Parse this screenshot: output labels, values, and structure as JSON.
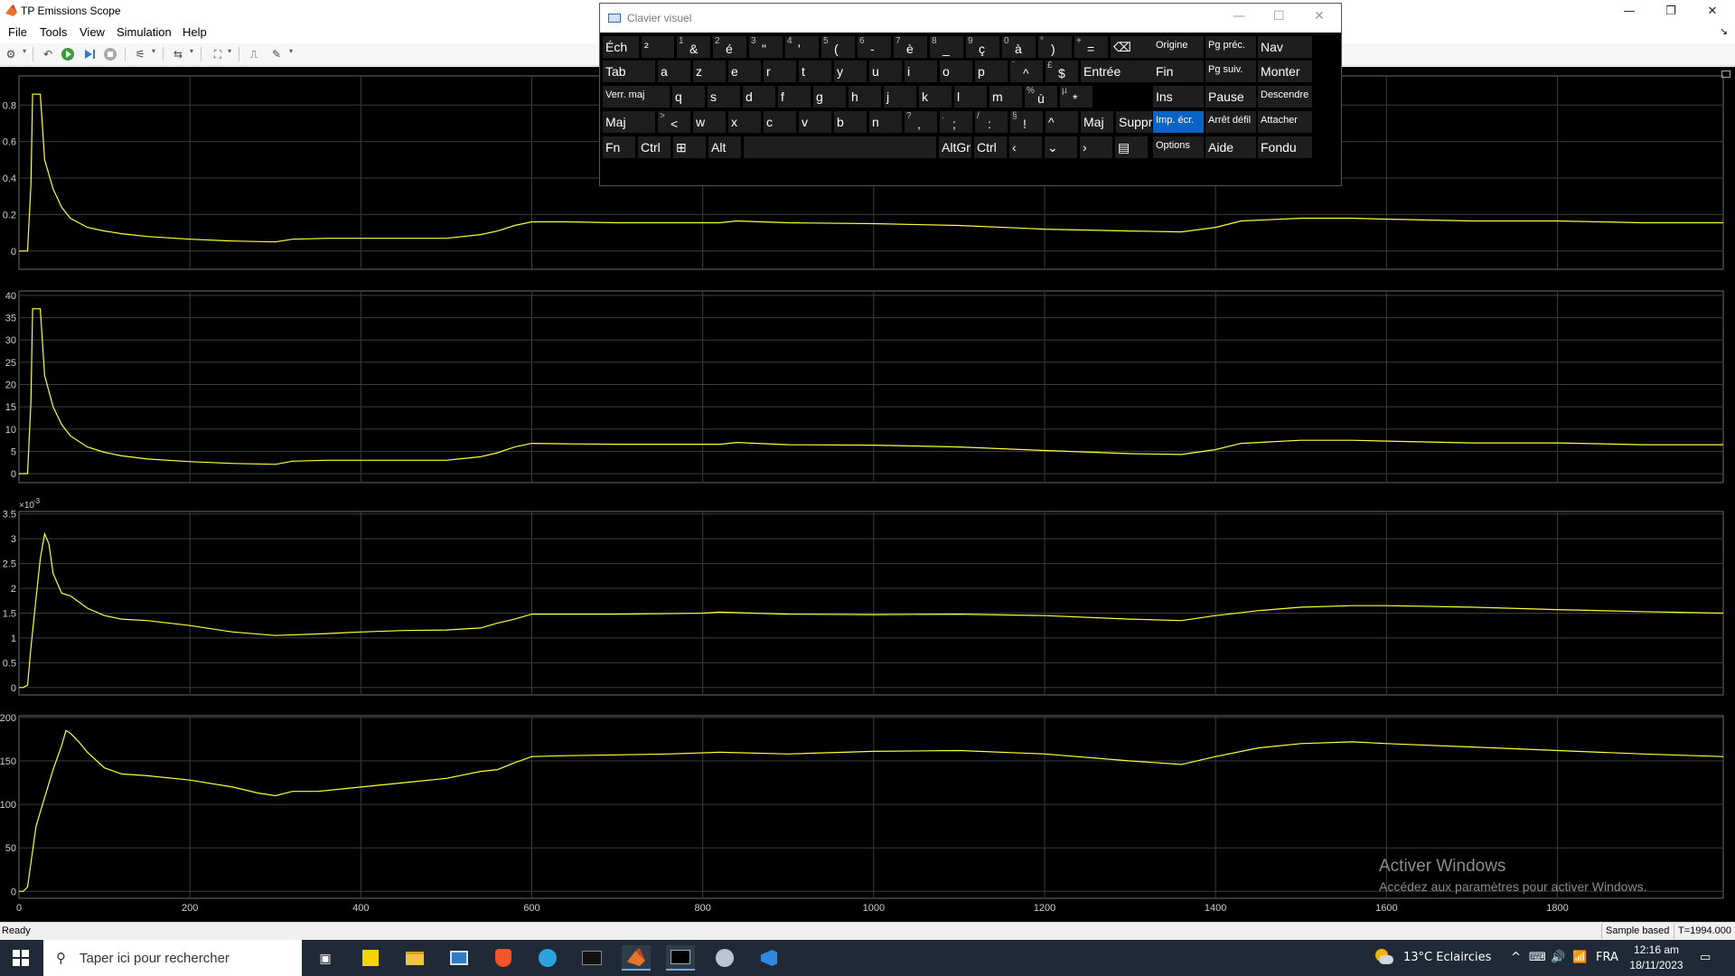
{
  "window": {
    "title": "TP Emissions Scope",
    "controls": {
      "minimize": "—",
      "restore": "❐",
      "close": "✕"
    }
  },
  "menu": [
    "File",
    "Tools",
    "View",
    "Simulation",
    "Help"
  ],
  "toolbar_icons": [
    "settings-icon",
    "restore-snapshot-icon",
    "run-icon",
    "step-forward-icon",
    "stop-icon",
    "signal-selector-icon",
    "zoom-icon",
    "fit-axes-icon",
    "trigger-icon",
    "measurements-icon"
  ],
  "chart_data": [
    {
      "type": "line",
      "yticks": [
        "0",
        "0.2",
        "0.4",
        "0.6",
        "0.8"
      ],
      "ylim": [
        -0.1,
        0.96
      ],
      "x": [
        0,
        5,
        10,
        14,
        16,
        20,
        25,
        30,
        40,
        50,
        60,
        80,
        100,
        120,
        150,
        200,
        250,
        300,
        320,
        360,
        400,
        450,
        500,
        540,
        560,
        580,
        600,
        640,
        700,
        760,
        820,
        840,
        900,
        1000,
        1100,
        1200,
        1300,
        1360,
        1400,
        1430,
        1500,
        1560,
        1600,
        1700,
        1800,
        1900,
        1994
      ],
      "values": [
        0,
        0,
        0,
        0.36,
        0.86,
        0.86,
        0.86,
        0.5,
        0.34,
        0.24,
        0.18,
        0.13,
        0.11,
        0.095,
        0.08,
        0.065,
        0.055,
        0.05,
        0.065,
        0.07,
        0.07,
        0.07,
        0.07,
        0.09,
        0.11,
        0.14,
        0.16,
        0.16,
        0.155,
        0.155,
        0.155,
        0.165,
        0.155,
        0.15,
        0.14,
        0.12,
        0.11,
        0.105,
        0.13,
        0.165,
        0.18,
        0.18,
        0.175,
        0.165,
        0.165,
        0.155,
        0.155
      ]
    },
    {
      "type": "line",
      "yticks": [
        "0",
        "5",
        "10",
        "15",
        "20",
        "25",
        "30",
        "35",
        "40"
      ],
      "ylim": [
        -2,
        41
      ],
      "x": [
        0,
        5,
        10,
        14,
        16,
        20,
        25,
        30,
        40,
        50,
        60,
        80,
        100,
        120,
        150,
        200,
        250,
        300,
        320,
        360,
        400,
        450,
        500,
        540,
        560,
        580,
        600,
        640,
        700,
        760,
        820,
        840,
        900,
        1000,
        1100,
        1200,
        1300,
        1360,
        1400,
        1430,
        1500,
        1560,
        1600,
        1700,
        1800,
        1900,
        1994
      ],
      "values": [
        0,
        0,
        0,
        16,
        37,
        37,
        37,
        22,
        15,
        11,
        8.5,
        6,
        4.8,
        4,
        3.3,
        2.7,
        2.3,
        2.1,
        2.8,
        3,
        3,
        3,
        3,
        3.8,
        4.7,
        6,
        6.8,
        6.7,
        6.6,
        6.6,
        6.6,
        7,
        6.5,
        6.4,
        6,
        5.2,
        4.5,
        4.3,
        5.4,
        6.8,
        7.5,
        7.5,
        7.3,
        6.9,
        6.9,
        6.5,
        6.5
      ]
    },
    {
      "type": "line",
      "exponent_label": "×10",
      "exponent_power": "-3",
      "yticks": [
        "0",
        "0.5",
        "1",
        "1.5",
        "2",
        "2.5",
        "3",
        "3.5"
      ],
      "ylim": [
        -0.15,
        3.55
      ],
      "x": [
        0,
        5,
        10,
        14,
        20,
        25,
        30,
        35,
        40,
        50,
        60,
        80,
        100,
        120,
        150,
        200,
        250,
        300,
        350,
        400,
        450,
        500,
        540,
        560,
        580,
        600,
        700,
        800,
        820,
        900,
        1000,
        1100,
        1200,
        1300,
        1360,
        1400,
        1450,
        1500,
        1560,
        1600,
        1700,
        1800,
        1900,
        1994
      ],
      "values": [
        0,
        0,
        0.05,
        0.8,
        1.8,
        2.6,
        3.1,
        2.9,
        2.3,
        1.9,
        1.85,
        1.6,
        1.45,
        1.38,
        1.35,
        1.25,
        1.12,
        1.05,
        1.08,
        1.12,
        1.15,
        1.16,
        1.2,
        1.3,
        1.38,
        1.48,
        1.48,
        1.5,
        1.52,
        1.48,
        1.47,
        1.48,
        1.45,
        1.38,
        1.35,
        1.45,
        1.55,
        1.62,
        1.65,
        1.65,
        1.62,
        1.57,
        1.53,
        1.5
      ]
    },
    {
      "type": "line",
      "yticks": [
        "0",
        "50",
        "100",
        "150",
        "200"
      ],
      "ylim": [
        -8,
        202
      ],
      "x": [
        0,
        5,
        10,
        15,
        20,
        30,
        40,
        50,
        55,
        60,
        70,
        80,
        100,
        120,
        150,
        200,
        250,
        280,
        300,
        320,
        350,
        400,
        450,
        500,
        540,
        560,
        580,
        600,
        640,
        700,
        760,
        820,
        900,
        1000,
        1100,
        1200,
        1300,
        1360,
        1400,
        1450,
        1500,
        1560,
        1600,
        1700,
        1800,
        1900,
        1994
      ],
      "values": [
        0,
        0,
        5,
        40,
        75,
        108,
        140,
        168,
        185,
        182,
        172,
        160,
        142,
        135,
        133,
        128,
        120,
        113,
        110,
        115,
        115,
        120,
        125,
        130,
        138,
        140,
        148,
        155,
        156,
        157,
        158,
        160,
        158,
        161,
        162,
        158,
        150,
        146,
        155,
        165,
        170,
        172,
        170,
        166,
        162,
        158,
        155
      ]
    }
  ],
  "x_axis": {
    "ticks": [
      "0",
      "200",
      "400",
      "600",
      "800",
      "1000",
      "1200",
      "1400",
      "1600",
      "1800"
    ],
    "xlim": [
      0,
      1994
    ]
  },
  "watermark": {
    "line1": "Activer Windows",
    "line2": "Accédez aux paramètres pour activer Windows."
  },
  "status": {
    "left": "Ready",
    "mode": "Sample based",
    "time": "T=1994.000"
  },
  "keyboard": {
    "title": "Clavier visuel",
    "controls": {
      "minimize": "—",
      "maximize": "☐",
      "close": "✕"
    },
    "row1": [
      {
        "main": "Éch"
      },
      {
        "main": "²"
      },
      {
        "sup": "1",
        "main": "&"
      },
      {
        "sup": "2",
        "main": "é"
      },
      {
        "sup": "3",
        "main": "\""
      },
      {
        "sup": "4",
        "main": "'"
      },
      {
        "sup": "5",
        "main": "("
      },
      {
        "sup": "6",
        "main": "-"
      },
      {
        "sup": "7",
        "main": "è"
      },
      {
        "sup": "8",
        "main": "_"
      },
      {
        "sup": "9",
        "main": "ç"
      },
      {
        "sup": "0",
        "main": "à"
      },
      {
        "sup": "°",
        "main": ")"
      },
      {
        "sup": "+",
        "main": "="
      },
      {
        "main": "⌫"
      }
    ],
    "row2": [
      {
        "main": "Tab"
      },
      {
        "main": "a"
      },
      {
        "main": "z"
      },
      {
        "main": "e"
      },
      {
        "main": "r"
      },
      {
        "main": "t"
      },
      {
        "main": "y"
      },
      {
        "main": "u"
      },
      {
        "main": "i"
      },
      {
        "main": "o"
      },
      {
        "main": "p"
      },
      {
        "sup": "¨",
        "main": "^"
      },
      {
        "sup": "£",
        "main": "$"
      },
      {
        "main": "Entrée"
      }
    ],
    "row3": [
      {
        "main": "Verr. maj"
      },
      {
        "main": "q"
      },
      {
        "main": "s"
      },
      {
        "main": "d"
      },
      {
        "main": "f"
      },
      {
        "main": "g"
      },
      {
        "main": "h"
      },
      {
        "main": "j"
      },
      {
        "main": "k"
      },
      {
        "main": "l"
      },
      {
        "main": "m"
      },
      {
        "sup": "%",
        "main": "ù"
      },
      {
        "sup": "µ",
        "main": "*"
      }
    ],
    "row4": [
      {
        "main": "Maj"
      },
      {
        "sup": ">",
        "main": "<"
      },
      {
        "main": "w"
      },
      {
        "main": "x"
      },
      {
        "main": "c"
      },
      {
        "main": "v"
      },
      {
        "main": "b"
      },
      {
        "main": "n"
      },
      {
        "sup": "?",
        "main": ","
      },
      {
        "sup": ".",
        "main": ";"
      },
      {
        "sup": "/",
        "main": ":"
      },
      {
        "sup": "§",
        "main": "!"
      },
      {
        "main": "^"
      },
      {
        "main": "Maj"
      },
      {
        "main": "Suppr"
      }
    ],
    "row5": [
      {
        "main": "Fn"
      },
      {
        "main": "Ctrl"
      },
      {
        "main": "⊞"
      },
      {
        "main": "Alt"
      },
      {
        "main": ""
      },
      {
        "main": "AltGr"
      },
      {
        "main": "Ctrl"
      },
      {
        "main": "‹"
      },
      {
        "main": "⌄"
      },
      {
        "main": "›"
      },
      {
        "main": "▤"
      }
    ],
    "nav": [
      [
        "Origine",
        "Pg préc.",
        "Nav"
      ],
      [
        "Fin",
        "Pg suiv.",
        "Monter"
      ],
      [
        "Ins",
        "Pause",
        "Descendre"
      ],
      [
        "Imp. écr.",
        "Arrêt défil",
        "Attacher"
      ],
      [
        "Options",
        "Aide",
        "Fondu"
      ]
    ]
  },
  "taskbar": {
    "search_placeholder": "Taper ici pour rechercher",
    "apps": [
      "task-view",
      "sticky-notes",
      "file-explorer",
      "remote-desktop",
      "brave",
      "telegram",
      "terminal",
      "matlab",
      "command-prompt",
      "steam",
      "vscode"
    ],
    "weather": "13°C  Eclaircies",
    "language": "FRA",
    "time": "12:16 am",
    "date": "18/11/2023"
  }
}
